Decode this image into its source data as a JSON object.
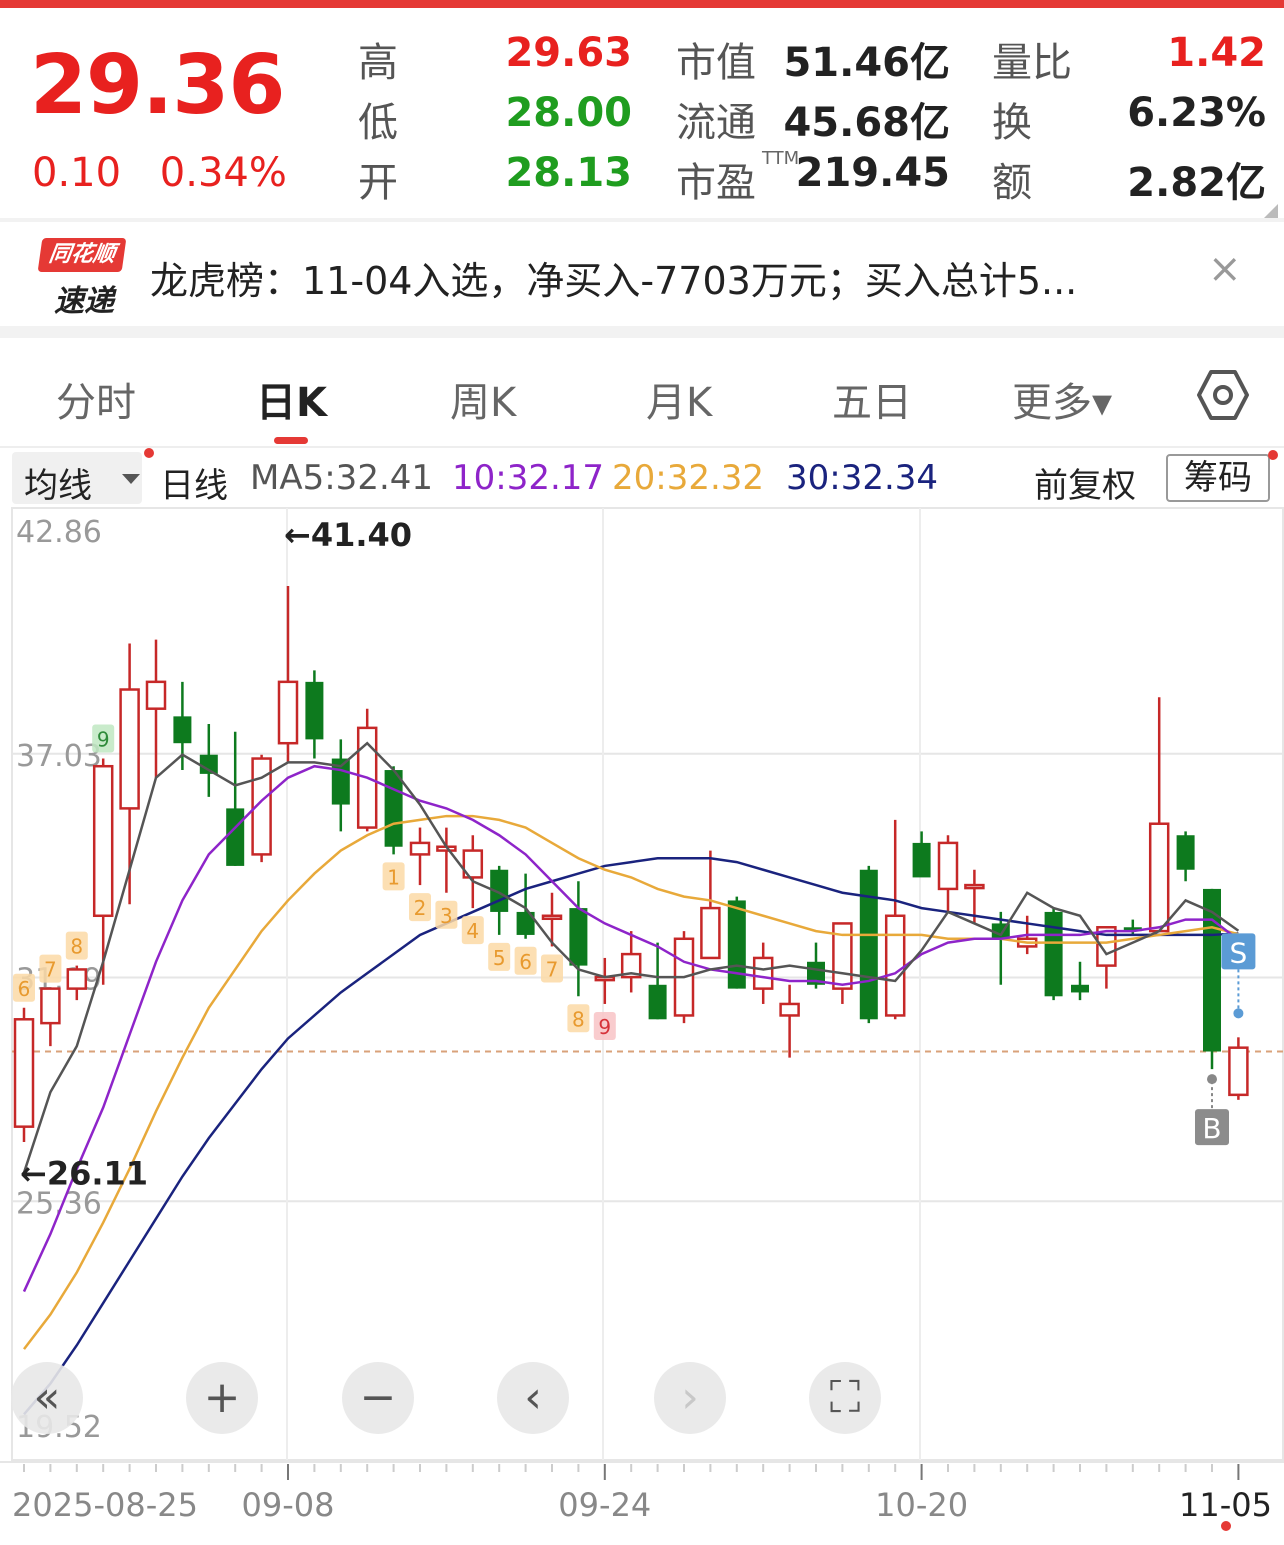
{
  "quote": {
    "price": "29.36",
    "change": "0.10",
    "change_pct": "0.34%",
    "high_label": "高",
    "high": "29.63",
    "low_label": "低",
    "low": "28.00",
    "open_label": "开",
    "open": "28.13",
    "mktcap_label": "市值",
    "mktcap": "51.46亿",
    "float_label": "流通",
    "float": "45.68亿",
    "pe_label": "市盈",
    "pe_sup": "TTM",
    "pe": "219.45",
    "volratio_label": "量比",
    "volratio": "1.42",
    "turnover_label": "换",
    "turnover": "6.23%",
    "amount_label": "额",
    "amount": "2.82亿"
  },
  "news": {
    "logo_top": "同花顺",
    "logo_bottom": "速递",
    "text": "龙虎榜：11-04入选，净买入-7703万元；买入总计5...",
    "close": "×"
  },
  "tabs": [
    {
      "label": "分时"
    },
    {
      "label": "日K"
    },
    {
      "label": "周K"
    },
    {
      "label": "月K"
    },
    {
      "label": "五日"
    },
    {
      "label": "更多▾"
    }
  ],
  "ma_bar": {
    "select": "均线",
    "period": "日线",
    "ma5": "MA5:32.41",
    "ma10": "10:32.17",
    "ma20": "20:32.32",
    "ma30": "30:32.34",
    "adjust": "前复权",
    "chips": "筹码"
  },
  "colors": {
    "up": "#c62828",
    "down": "#0d7a1e",
    "ma5": "#555555",
    "ma10": "#8e24c9",
    "ma20": "#e8a93a",
    "ma30": "#1a237e",
    "accent": "#e53935"
  },
  "chart_data": {
    "type": "candlestick",
    "ylim": [
      19.52,
      42.86
    ],
    "y_ticks": [
      "42.86",
      "37.03",
      "31.19",
      "25.36",
      "19.52"
    ],
    "x_labels": [
      "2025-08-25",
      "09-08",
      "09-24",
      "10-20",
      "11-05"
    ],
    "x_label_index": [
      0,
      10,
      22,
      34,
      46
    ],
    "high_marker": "←41.40",
    "low_marker": "←26.11",
    "prev_close": 29.26,
    "candles": [
      {
        "o": 27.3,
        "h": 30.4,
        "l": 26.9,
        "c": 30.1
      },
      {
        "o": 30.0,
        "h": 30.9,
        "l": 29.4,
        "c": 30.9
      },
      {
        "o": 30.9,
        "h": 31.5,
        "l": 30.6,
        "c": 31.4
      },
      {
        "o": 32.8,
        "h": 36.9,
        "l": 31.0,
        "c": 36.7
      },
      {
        "o": 35.6,
        "h": 39.9,
        "l": 33.1,
        "c": 38.7
      },
      {
        "o": 38.2,
        "h": 40.0,
        "l": 36.4,
        "c": 38.9
      },
      {
        "o": 38.0,
        "h": 38.9,
        "l": 36.6,
        "c": 37.3
      },
      {
        "o": 37.0,
        "h": 37.8,
        "l": 35.9,
        "c": 36.5
      },
      {
        "o": 35.6,
        "h": 37.6,
        "l": 34.1,
        "c": 34.1
      },
      {
        "o": 34.4,
        "h": 37.0,
        "l": 34.2,
        "c": 36.9
      },
      {
        "o": 37.3,
        "h": 41.4,
        "l": 36.8,
        "c": 38.9
      },
      {
        "o": 38.9,
        "h": 39.2,
        "l": 36.9,
        "c": 37.4
      },
      {
        "o": 36.9,
        "h": 37.4,
        "l": 35.0,
        "c": 35.7
      },
      {
        "o": 35.1,
        "h": 38.2,
        "l": 35.0,
        "c": 37.7
      },
      {
        "o": 36.6,
        "h": 36.7,
        "l": 34.4,
        "c": 34.6
      },
      {
        "o": 34.4,
        "h": 35.1,
        "l": 33.6,
        "c": 34.7
      },
      {
        "o": 34.5,
        "h": 35.1,
        "l": 33.4,
        "c": 34.6
      },
      {
        "o": 33.8,
        "h": 34.9,
        "l": 33.0,
        "c": 34.5
      },
      {
        "o": 34.0,
        "h": 34.1,
        "l": 32.3,
        "c": 32.9
      },
      {
        "o": 32.9,
        "h": 33.9,
        "l": 32.2,
        "c": 32.3
      },
      {
        "o": 32.8,
        "h": 33.4,
        "l": 32.0,
        "c": 32.8
      },
      {
        "o": 33.0,
        "h": 33.7,
        "l": 30.7,
        "c": 31.5
      },
      {
        "o": 31.2,
        "h": 31.7,
        "l": 30.5,
        "c": 31.2
      },
      {
        "o": 31.2,
        "h": 32.4,
        "l": 30.8,
        "c": 31.8
      },
      {
        "o": 31.0,
        "h": 32.1,
        "l": 30.1,
        "c": 30.1
      },
      {
        "o": 30.2,
        "h": 32.4,
        "l": 30.0,
        "c": 32.2
      },
      {
        "o": 31.7,
        "h": 34.5,
        "l": 31.7,
        "c": 33.0
      },
      {
        "o": 33.2,
        "h": 33.3,
        "l": 30.9,
        "c": 30.9
      },
      {
        "o": 30.9,
        "h": 32.1,
        "l": 30.5,
        "c": 31.7
      },
      {
        "o": 30.2,
        "h": 31.0,
        "l": 29.1,
        "c": 30.5
      },
      {
        "o": 31.6,
        "h": 32.1,
        "l": 30.9,
        "c": 31.0
      },
      {
        "o": 30.9,
        "h": 32.1,
        "l": 30.5,
        "c": 32.6
      },
      {
        "o": 34.0,
        "h": 34.1,
        "l": 30.0,
        "c": 30.1
      },
      {
        "o": 30.2,
        "h": 35.3,
        "l": 30.1,
        "c": 32.8
      },
      {
        "o": 34.7,
        "h": 35.0,
        "l": 33.9,
        "c": 33.8
      },
      {
        "o": 33.5,
        "h": 34.9,
        "l": 32.9,
        "c": 34.7
      },
      {
        "o": 33.6,
        "h": 34.0,
        "l": 32.6,
        "c": 33.6
      },
      {
        "o": 32.6,
        "h": 32.9,
        "l": 31.0,
        "c": 32.2
      },
      {
        "o": 32.0,
        "h": 32.8,
        "l": 31.8,
        "c": 32.2
      },
      {
        "o": 32.9,
        "h": 33.0,
        "l": 30.6,
        "c": 30.7
      },
      {
        "o": 31.0,
        "h": 31.6,
        "l": 30.6,
        "c": 30.8
      },
      {
        "o": 31.5,
        "h": 32.3,
        "l": 30.9,
        "c": 32.5
      },
      {
        "o": 32.5,
        "h": 32.7,
        "l": 32.3,
        "c": 32.4
      },
      {
        "o": 32.4,
        "h": 38.5,
        "l": 32.4,
        "c": 35.2
      },
      {
        "o": 34.9,
        "h": 35.0,
        "l": 33.7,
        "c": 34.0
      },
      {
        "o": 33.5,
        "h": 33.5,
        "l": 28.8,
        "c": 29.26
      },
      {
        "o": 28.13,
        "h": 29.63,
        "l": 28.0,
        "c": 29.36
      }
    ],
    "ma5": [
      26.1,
      28.2,
      29.4,
      31.6,
      34.0,
      36.4,
      37.0,
      36.6,
      36.2,
      36.4,
      36.8,
      36.8,
      36.7,
      37.3,
      36.6,
      35.7,
      34.6,
      33.7,
      33.4,
      33.0,
      32.1,
      31.4,
      31.2,
      31.3,
      31.2,
      31.2,
      31.4,
      31.5,
      31.4,
      31.5,
      31.4,
      31.3,
      31.2,
      31.1,
      31.9,
      32.9,
      32.6,
      32.3,
      33.4,
      33.0,
      32.8,
      31.8,
      32.1,
      32.4,
      33.2,
      32.9,
      32.41
    ],
    "ma10": [
      23.0,
      24.5,
      26.2,
      27.8,
      29.7,
      31.6,
      33.2,
      34.4,
      35.1,
      35.8,
      36.4,
      36.7,
      36.6,
      36.4,
      36.1,
      35.8,
      35.6,
      35.3,
      34.9,
      34.4,
      33.7,
      33.0,
      32.6,
      32.3,
      32.0,
      31.6,
      31.4,
      31.3,
      31.2,
      31.1,
      31.1,
      31.0,
      31.1,
      31.3,
      31.8,
      32.1,
      32.2,
      32.2,
      32.3,
      32.3,
      32.3,
      32.4,
      32.4,
      32.5,
      32.7,
      32.7,
      32.17
    ],
    "ma20": [
      21.5,
      22.4,
      23.5,
      24.8,
      26.2,
      27.7,
      29.1,
      30.4,
      31.4,
      32.4,
      33.2,
      33.9,
      34.5,
      34.9,
      35.2,
      35.3,
      35.4,
      35.4,
      35.3,
      35.1,
      34.7,
      34.3,
      34.0,
      33.8,
      33.5,
      33.3,
      33.2,
      33.0,
      32.8,
      32.6,
      32.4,
      32.3,
      32.3,
      32.3,
      32.3,
      32.2,
      32.2,
      32.2,
      32.1,
      32.1,
      32.1,
      32.1,
      32.2,
      32.3,
      32.4,
      32.5,
      32.32
    ],
    "ma30": [
      19.8,
      20.6,
      21.6,
      22.7,
      23.8,
      24.9,
      26.0,
      27.0,
      27.9,
      28.8,
      29.6,
      30.2,
      30.8,
      31.3,
      31.8,
      32.3,
      32.6,
      32.9,
      33.2,
      33.5,
      33.7,
      33.9,
      34.1,
      34.2,
      34.3,
      34.3,
      34.3,
      34.2,
      34.0,
      33.8,
      33.6,
      33.4,
      33.3,
      33.2,
      33.0,
      32.9,
      32.8,
      32.7,
      32.6,
      32.5,
      32.4,
      32.3,
      32.3,
      32.3,
      32.3,
      32.3,
      32.34
    ],
    "sequence_marks": [
      {
        "i": 0,
        "t": "6",
        "up": true
      },
      {
        "i": 1,
        "t": "7",
        "up": true
      },
      {
        "i": 2,
        "t": "8",
        "up": true
      },
      {
        "i": 3,
        "t": "9",
        "up": true,
        "green": true
      },
      {
        "i": 14,
        "t": "1",
        "up": false
      },
      {
        "i": 15,
        "t": "2",
        "up": false
      },
      {
        "i": 16,
        "t": "3",
        "up": false
      },
      {
        "i": 17,
        "t": "4",
        "up": false
      },
      {
        "i": 18,
        "t": "5",
        "up": false
      },
      {
        "i": 19,
        "t": "6",
        "up": false
      },
      {
        "i": 20,
        "t": "7",
        "up": false
      },
      {
        "i": 21,
        "t": "8",
        "up": false
      },
      {
        "i": 22,
        "t": "9",
        "up": false,
        "pink": true
      }
    ],
    "signals": [
      {
        "i": 45,
        "t": "B"
      },
      {
        "i": 46,
        "t": "S"
      }
    ]
  },
  "controls": [
    {
      "name": "collapse-left-button",
      "icon": "double-chevron-left-icon",
      "glyph": "«"
    },
    {
      "name": "zoom-in-button",
      "icon": "plus-icon",
      "glyph": "+"
    },
    {
      "name": "zoom-out-button",
      "icon": "minus-icon",
      "glyph": "−"
    },
    {
      "name": "prev-button",
      "icon": "chevron-left-icon",
      "glyph": "‹"
    },
    {
      "name": "next-button",
      "icon": "chevron-right-icon",
      "glyph": "›"
    },
    {
      "name": "fullscreen-button",
      "icon": "fullscreen-icon",
      "glyph": "⛶"
    }
  ]
}
